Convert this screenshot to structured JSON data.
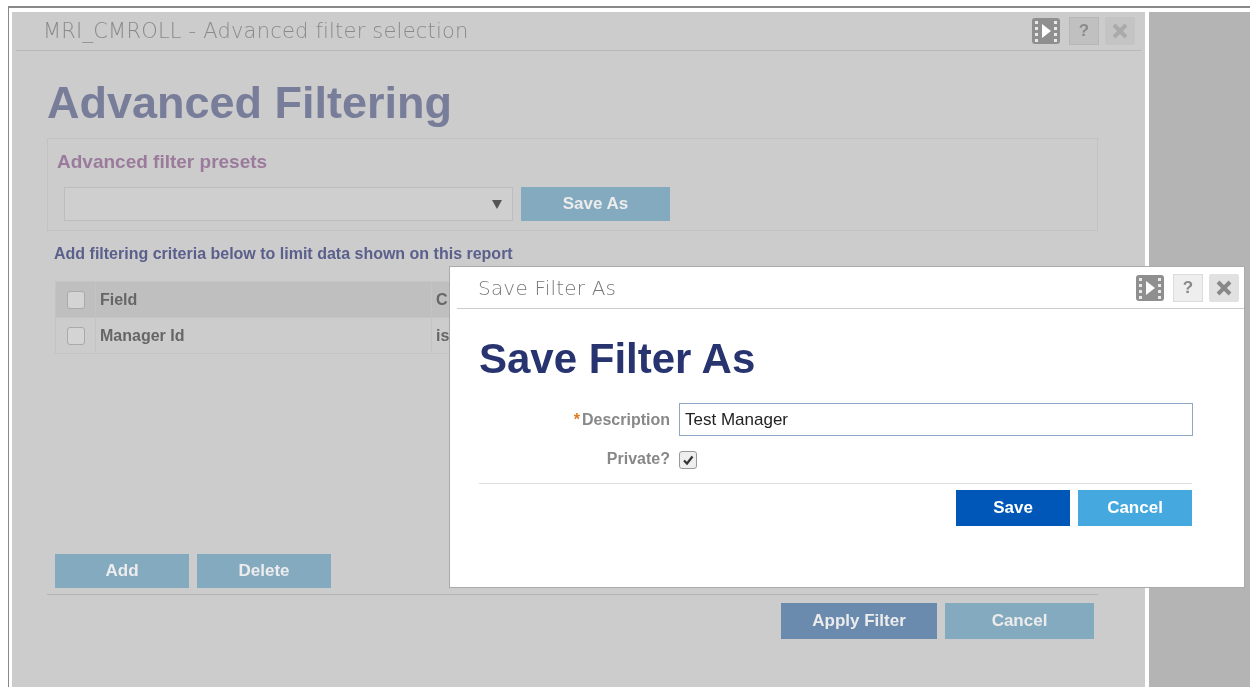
{
  "window": {
    "title": "MRI_CMROLL - Advanced filter selection",
    "help_label": "?"
  },
  "heading": "Advanced Filtering",
  "presets": {
    "label": "Advanced filter presets",
    "save_as_button": "Save As"
  },
  "criteria_hint": "Add filtering criteria below to limit data shown on this report",
  "table": {
    "header_checked": false,
    "columns": [
      "Field",
      "C"
    ],
    "rows": [
      {
        "checked": false,
        "cells": [
          "Manager Id",
          "is"
        ]
      }
    ]
  },
  "table_buttons": [
    "Add",
    "Delete"
  ],
  "footer_buttons": [
    {
      "label": "Apply Filter",
      "kind": "primary"
    },
    {
      "label": "Cancel",
      "kind": "secondary"
    }
  ],
  "dialog": {
    "title": "Save Filter As",
    "help_label": "?",
    "heading": "Save Filter As",
    "description": {
      "label": "Description",
      "required_mark": "*",
      "value": "Test Manager"
    },
    "private": {
      "label": "Private?",
      "checked": true
    },
    "buttons": [
      {
        "label": "Save",
        "kind": "primary"
      },
      {
        "label": "Cancel",
        "kind": "secondary"
      }
    ]
  }
}
